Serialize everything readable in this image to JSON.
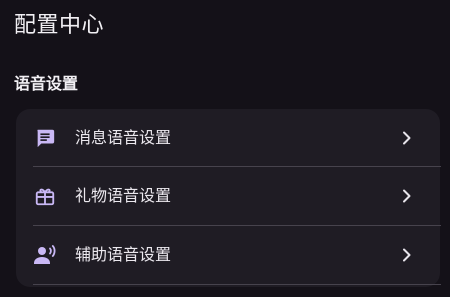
{
  "header": {
    "title": "配置中心"
  },
  "section": {
    "title": "语音设置"
  },
  "settings": {
    "items": [
      {
        "label": "消息语音设置",
        "icon": "message-icon"
      },
      {
        "label": "礼物语音设置",
        "icon": "gift-icon"
      },
      {
        "label": "辅助语音设置",
        "icon": "voice-user-icon"
      }
    ]
  },
  "colors": {
    "background": "#141118",
    "card": "#1f1c24",
    "icon_accent": "#c9b8f5",
    "divider": "#47434d",
    "text": "#ece9ef"
  }
}
